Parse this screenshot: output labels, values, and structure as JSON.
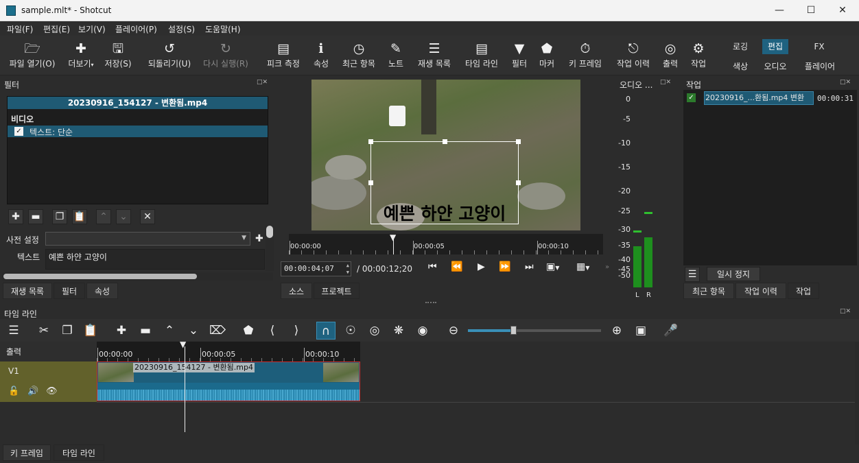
{
  "window": {
    "title": "sample.mlt* - Shotcut"
  },
  "menu": [
    "파일(F)",
    "편집(E)",
    "보기(V)",
    "플레이어(P)",
    "설정(S)",
    "도움말(H)"
  ],
  "toolbar": {
    "items": [
      "파일 열기(O)",
      "더보기",
      "저장(S)",
      "되돌리기(U)",
      "다시 실행(R)",
      "피크 측정",
      "속성",
      "최근 항목",
      "노트",
      "재생 목록",
      "타임 라인",
      "필터",
      "마커",
      "키 프레임",
      "작업 이력",
      "출력",
      "작업"
    ],
    "layouts_top": [
      "로깅",
      "편집",
      "FX"
    ],
    "layouts_bottom": [
      "색상",
      "오디오",
      "플레이어"
    ]
  },
  "filter_panel": {
    "title": "필터",
    "clip_name": "20230916_154127 - 변환됨.mp4",
    "section": "비디오",
    "filter_item": "텍스트: 단순",
    "preset_label": "사전 설정",
    "text_label": "텍스트",
    "text_value": "예쁜 하얀 고양이",
    "tabs": [
      "재생 목록",
      "필터",
      "속성"
    ]
  },
  "player": {
    "overlay_text": "예쁜 하얀 고양이",
    "ruler_ticks": [
      "00:00:00",
      "00:00:05",
      "00:00:10"
    ],
    "timecode": "00:00:04;07",
    "duration": "/ 00:00:12;20",
    "tabs": [
      "소스",
      "프로젝트"
    ]
  },
  "audio_meter": {
    "title": "오디오 ...",
    "scale": [
      "0",
      "-5",
      "-10",
      "-15",
      "-20",
      "-25",
      "-30",
      "-35",
      "-40",
      "-45",
      "-50"
    ],
    "channels": [
      "L",
      "R"
    ]
  },
  "jobs_panel": {
    "title": "작업",
    "job_name": "20230916_...환됨.mp4 변환",
    "job_time": "00:00:31",
    "pause_label": "일시 정지",
    "tabs": [
      "최근 항목",
      "작업 이력",
      "작업"
    ]
  },
  "timeline": {
    "title": "타임 라인",
    "output_label": "출력",
    "track_name": "V1",
    "ruler_ticks": [
      "00:00:00",
      "00:00:05",
      "00:00:10"
    ],
    "clip_label": "20230916_154127 - 변환됨.mp4",
    "bottom_tabs": [
      "키 프레임",
      "타임 라인"
    ]
  },
  "colors": {
    "accent": "#1f6280",
    "track_header": "#62612b",
    "clip_blue": "#1d5e7b",
    "selection": "#d02a2a"
  }
}
